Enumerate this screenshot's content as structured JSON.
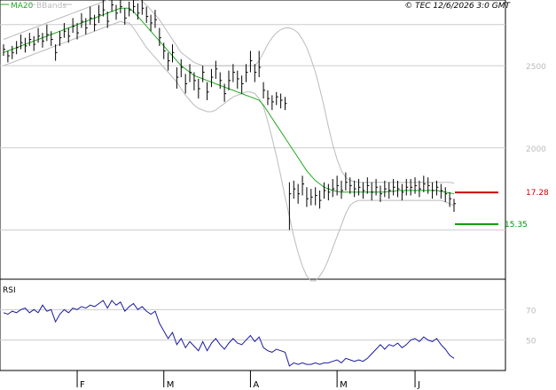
{
  "header": {
    "legend_ma": "MA20",
    "legend_bb": "BBands",
    "copyright": "© TEC 12/6/2026 3:0 GMT"
  },
  "colors": {
    "price_bars": "#000000",
    "ma20": "#22aa22",
    "bbands": "#bbbbbb",
    "rsi": "#1a1aa0",
    "resistance": "#cc0000",
    "support": "#009900",
    "grid": "#cccccc"
  },
  "chart_data": [
    {
      "type": "ohlc",
      "ylim": [
        12,
        29
      ],
      "y_ticks": [
        {
          "value": 25,
          "label": "2500"
        },
        {
          "value": 20,
          "label": "2000"
        }
      ],
      "gridlines": [
        27.5,
        25,
        20,
        15
      ],
      "x_ticks": [
        {
          "index": 17,
          "label": "F"
        },
        {
          "index": 37,
          "label": "M"
        },
        {
          "index": 57,
          "label": "A"
        },
        {
          "index": 77,
          "label": "M"
        },
        {
          "index": 95,
          "label": "J"
        }
      ],
      "levels": [
        {
          "name": "resistance",
          "value": 17.28,
          "label": "17.28"
        },
        {
          "name": "support",
          "value": 15.35,
          "label": "15.35"
        }
      ],
      "close": [
        26.0,
        25.6,
        25.8,
        26.1,
        26.4,
        26.2,
        26.6,
        26.3,
        26.8,
        26.5,
        26.9,
        26.6,
        25.8,
        26.7,
        27.1,
        26.8,
        27.4,
        27.0,
        27.7,
        27.3,
        27.9,
        27.5,
        28.1,
        28.4,
        27.7,
        28.7,
        28.2,
        28.6,
        27.9,
        28.4,
        28.6,
        28.2,
        28.5,
        28.0,
        27.6,
        27.8,
        26.7,
        25.9,
        25.3,
        25.8,
        24.3,
        24.9,
        23.9,
        24.6,
        24.1,
        23.6,
        24.6,
        23.4,
        24.3,
        24.8,
        24.1,
        23.3,
        24.1,
        24.6,
        24.2,
        23.9,
        24.6,
        25.3,
        24.6,
        24.9,
        23.5,
        23.0,
        22.8,
        23.1,
        22.9,
        22.7,
        17.2,
        17.5,
        17.2,
        17.8,
        16.9,
        17.0,
        17.1,
        16.8,
        17.4,
        17.3,
        17.5,
        17.7,
        17.4,
        17.9,
        17.7,
        17.5,
        17.6,
        17.4,
        17.7,
        17.3,
        17.6,
        17.2,
        17.5,
        17.4,
        17.6,
        17.5,
        17.3,
        17.6,
        17.6,
        17.7,
        17.5,
        17.8,
        17.7,
        17.4,
        17.6,
        17.4,
        17.2,
        16.9,
        16.6
      ],
      "high": [
        26.3,
        25.9,
        26.2,
        26.5,
        26.9,
        26.7,
        27.0,
        26.8,
        27.3,
        27.0,
        27.5,
        27.1,
        26.3,
        27.1,
        27.6,
        27.3,
        27.9,
        27.6,
        28.2,
        27.9,
        28.6,
        28.1,
        28.7,
        29.0,
        28.3,
        29.2,
        28.7,
        29.1,
        28.5,
        28.9,
        29.2,
        28.8,
        29.0,
        28.6,
        28.1,
        28.4,
        27.3,
        26.4,
        25.8,
        26.3,
        24.9,
        25.4,
        24.5,
        25.1,
        24.6,
        24.2,
        25.0,
        24.0,
        24.8,
        25.3,
        24.6,
        23.9,
        24.7,
        25.1,
        24.7,
        24.4,
        25.1,
        25.9,
        25.1,
        25.9,
        24.0,
        23.5,
        23.2,
        23.4,
        23.3,
        23.1,
        17.9,
        18.0,
        17.8,
        18.3,
        17.6,
        17.5,
        17.6,
        17.4,
        17.9,
        17.8,
        18.1,
        18.3,
        18.0,
        18.5,
        18.2,
        18.0,
        18.1,
        17.9,
        18.2,
        17.9,
        18.1,
        17.7,
        18.0,
        17.9,
        18.1,
        18.0,
        17.8,
        18.1,
        18.1,
        18.2,
        18.0,
        18.3,
        18.2,
        17.9,
        18.0,
        17.8,
        17.6,
        17.3,
        16.9
      ],
      "low": [
        25.6,
        25.2,
        25.4,
        25.7,
        26.0,
        25.8,
        26.2,
        25.9,
        26.4,
        26.1,
        26.5,
        26.2,
        25.3,
        26.2,
        26.7,
        26.4,
        27.0,
        26.6,
        27.3,
        26.9,
        27.5,
        27.1,
        27.6,
        28.0,
        27.3,
        28.3,
        27.8,
        28.2,
        27.5,
        28.0,
        28.2,
        27.8,
        28.1,
        27.6,
        27.1,
        27.3,
        26.2,
        25.4,
        24.7,
        25.2,
        23.6,
        24.3,
        23.3,
        24.0,
        23.5,
        23.0,
        24.0,
        22.9,
        23.7,
        24.2,
        23.6,
        22.8,
        23.5,
        24.0,
        23.6,
        23.3,
        24.0,
        24.6,
        24.0,
        24.3,
        23.0,
        22.6,
        22.3,
        22.6,
        22.4,
        22.3,
        15.0,
        16.9,
        16.6,
        17.1,
        16.4,
        16.5,
        16.5,
        16.3,
        16.9,
        16.8,
        17.0,
        17.1,
        16.9,
        17.4,
        17.2,
        17.0,
        17.1,
        16.9,
        17.2,
        16.8,
        17.1,
        16.7,
        17.0,
        16.9,
        17.1,
        17.0,
        16.8,
        17.1,
        17.1,
        17.2,
        17.0,
        17.3,
        17.2,
        16.9,
        17.1,
        16.9,
        16.7,
        16.4,
        16.1
      ],
      "ma20": [
        25.8,
        25.9,
        26.0,
        26.1,
        26.2,
        26.3,
        26.4,
        26.5,
        26.6,
        26.7,
        26.8,
        26.9,
        27.0,
        27.1,
        27.2,
        27.3,
        27.4,
        27.5,
        27.6,
        27.7,
        27.8,
        27.9,
        28.0,
        28.1,
        28.2,
        28.3,
        28.4,
        28.5,
        28.5,
        28.5,
        28.3,
        28.0,
        27.7,
        27.4,
        27.1,
        26.8,
        26.5,
        26.2,
        25.9,
        25.6,
        25.3,
        25.0,
        24.8,
        24.6,
        24.4,
        24.3,
        24.2,
        24.1,
        24.0,
        23.9,
        23.8,
        23.7,
        23.6,
        23.5,
        23.4,
        23.3,
        23.2,
        23.1,
        23.0,
        22.9,
        22.6,
        22.2,
        21.8,
        21.4,
        21.0,
        20.6,
        20.2,
        19.8,
        19.4,
        19.0,
        18.6,
        18.3,
        18.0,
        17.8,
        17.6,
        17.5,
        17.4,
        17.35,
        17.3,
        17.3,
        17.3,
        17.3,
        17.3,
        17.3,
        17.3,
        17.3,
        17.3,
        17.3,
        17.3,
        17.35,
        17.35,
        17.4,
        17.4,
        17.4,
        17.4,
        17.4,
        17.4,
        17.4,
        17.4,
        17.4,
        17.4,
        17.35,
        17.3,
        17.25,
        17.2
      ],
      "bb_upper": [
        26.6,
        26.7,
        26.8,
        26.9,
        27.0,
        27.1,
        27.2,
        27.3,
        27.4,
        27.5,
        27.6,
        27.7,
        27.8,
        27.9,
        28.0,
        28.1,
        28.2,
        28.3,
        28.4,
        28.5,
        28.6,
        28.7,
        28.8,
        28.9,
        29.0,
        29.1,
        29.2,
        29.3,
        29.4,
        29.4,
        29.3,
        29.1,
        28.9,
        28.7,
        28.4,
        28.1,
        27.8,
        27.4,
        27.0,
        26.6,
        26.2,
        25.8,
        25.6,
        25.4,
        25.2,
        25.1,
        25.0,
        25.0,
        25.0,
        25.0,
        25.0,
        25.0,
        25.0,
        25.0,
        25.0,
        25.0,
        25.0,
        25.0,
        25.0,
        25.3,
        25.8,
        26.3,
        26.7,
        27.0,
        27.2,
        27.3,
        27.3,
        27.2,
        27.0,
        26.6,
        26.1,
        25.4,
        24.6,
        23.6,
        22.5,
        21.3,
        20.2,
        19.3,
        18.6,
        18.2,
        18.0,
        17.95,
        17.9,
        17.9,
        17.9,
        17.9,
        17.9,
        17.9,
        17.9,
        17.9,
        17.9,
        17.9,
        17.9,
        17.9,
        17.9,
        17.9,
        17.9,
        17.9,
        17.9,
        17.9,
        17.9,
        17.9,
        17.9,
        17.9,
        17.85
      ],
      "bb_lower": [
        25.0,
        25.1,
        25.2,
        25.3,
        25.4,
        25.5,
        25.6,
        25.7,
        25.8,
        25.9,
        26.0,
        26.1,
        26.2,
        26.3,
        26.4,
        26.5,
        26.6,
        26.7,
        26.8,
        26.9,
        27.0,
        27.1,
        27.2,
        27.3,
        27.4,
        27.5,
        27.6,
        27.7,
        27.6,
        27.6,
        27.3,
        26.9,
        26.5,
        26.1,
        25.8,
        25.5,
        25.2,
        24.9,
        24.6,
        24.3,
        24.0,
        23.6,
        23.2,
        22.9,
        22.6,
        22.4,
        22.3,
        22.2,
        22.2,
        22.3,
        22.5,
        22.7,
        22.9,
        23.1,
        23.2,
        23.3,
        23.4,
        23.4,
        23.3,
        23.0,
        22.5,
        21.6,
        20.6,
        19.5,
        18.3,
        17.0,
        15.8,
        14.6,
        13.6,
        12.8,
        12.2,
        11.9,
        11.9,
        12.2,
        12.6,
        13.2,
        13.9,
        14.6,
        15.3,
        16.0,
        16.5,
        16.7,
        16.8,
        16.8,
        16.8,
        16.8,
        16.8,
        16.8,
        16.8,
        16.8,
        16.8,
        16.8,
        16.8,
        16.8,
        16.8,
        16.8,
        16.8,
        16.8,
        16.8,
        16.8,
        16.8,
        16.8,
        16.7,
        16.6,
        16.5
      ]
    },
    {
      "type": "line",
      "title": "RSI",
      "ylim": [
        30,
        90
      ],
      "y_ticks": [
        {
          "value": 70,
          "label": "70"
        },
        {
          "value": 50,
          "label": "50"
        }
      ],
      "values": [
        68,
        67,
        69,
        68,
        70,
        71,
        68,
        70,
        68,
        73,
        69,
        70,
        62,
        67,
        70,
        68,
        71,
        70,
        72,
        71,
        73,
        72,
        74,
        76,
        71,
        76,
        73,
        75,
        69,
        72,
        74,
        70,
        72,
        69,
        67,
        69,
        61,
        56,
        51,
        55,
        47,
        51,
        45,
        49,
        46,
        43,
        49,
        43,
        48,
        51,
        47,
        44,
        48,
        51,
        48,
        47,
        50,
        53,
        49,
        52,
        45,
        43,
        42,
        44,
        43,
        42,
        33,
        35,
        34,
        35,
        34,
        34,
        35,
        34,
        35,
        35,
        36,
        37,
        35,
        38,
        37,
        36,
        37,
        36,
        38,
        41,
        44,
        47,
        44,
        47,
        46,
        48,
        45,
        47,
        50,
        51,
        49,
        52,
        50,
        49,
        51,
        47,
        44,
        40,
        38
      ]
    }
  ]
}
